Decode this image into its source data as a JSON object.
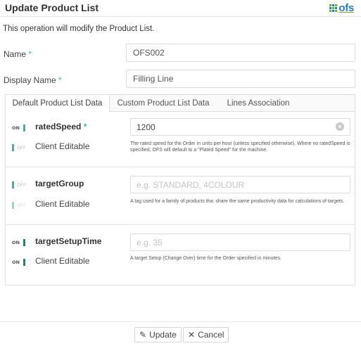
{
  "header": {
    "title": "Update Product List",
    "logo_text": "ofs"
  },
  "intro": "This operation will modify the Product List.",
  "fields": {
    "name_label": "Name",
    "name_value": "OFS002",
    "display_name_label": "Display Name",
    "display_name_value": "Filling Line",
    "required_mark": "*"
  },
  "tabs": [
    {
      "label": "Default Product List Data",
      "active": true
    },
    {
      "label": "Custom Product List Data",
      "active": false
    },
    {
      "label": "Lines Association",
      "active": false
    }
  ],
  "params": [
    {
      "name": "ratedSpeed",
      "required": true,
      "toggle_state": "ON",
      "client_editable_label": "Client Editable",
      "client_editable_state": "OFF",
      "value": "1200",
      "placeholder": "",
      "description": "The rated speed for the Order in units per hour (unless specified otherwise). Where no ratedSpeed is specified, OFS will default to a \"Plated Speed\" for the machine."
    },
    {
      "name": "targetGroup",
      "required": false,
      "toggle_state": "OFF",
      "client_editable_label": "Client Editable",
      "client_editable_state": "OFF",
      "value": "",
      "placeholder": "e.g. STANDARD, 4COLOUR",
      "description": "A tag used for a family of products tha: share the same productivity data for calculations of targets."
    },
    {
      "name": "targetSetupTime",
      "required": false,
      "toggle_state": "ON",
      "client_editable_label": "Client Editable",
      "client_editable_state": "ON",
      "value": "",
      "placeholder": "e.g. 35",
      "description": "A target Setup (Change Over) time for the Order specified in minutes."
    }
  ],
  "footer": {
    "update_label": "Update",
    "cancel_label": "Cancel"
  },
  "colors": {
    "accent": "#3bb5a8",
    "brand_blue": "#2b79c2",
    "brand_green": "#6fb229"
  }
}
